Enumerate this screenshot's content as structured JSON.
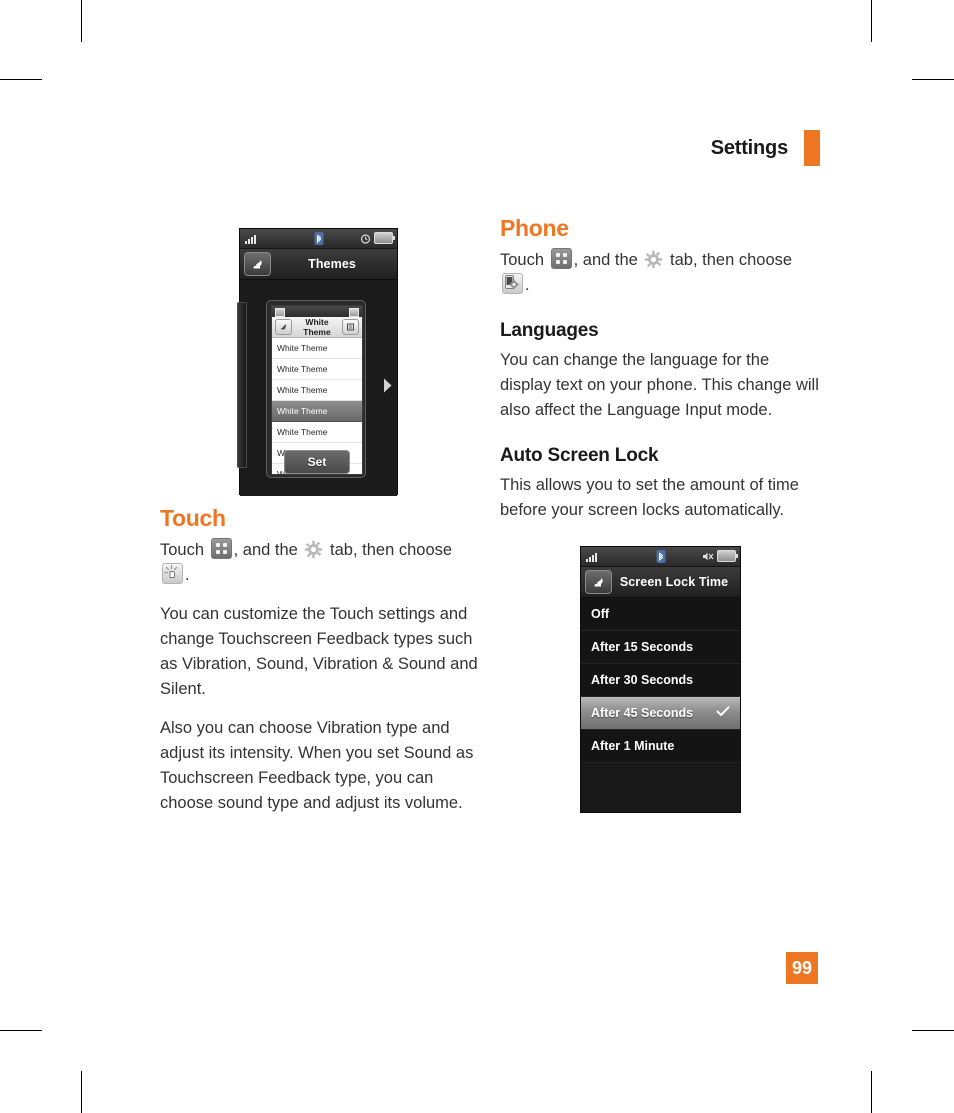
{
  "header": {
    "title": "Settings",
    "accent_color": "#EF7622"
  },
  "page_number": "99",
  "left_column": {
    "themes_screenshot": {
      "statusbar": {
        "signal_icon": "signal-bars-icon",
        "bluetooth_icon": "bluetooth-icon",
        "alarm_icon": "alarm-icon",
        "battery_icon": "battery-icon"
      },
      "back_icon": "back-arrow-icon",
      "title": "Themes",
      "preview": {
        "title": "White Theme",
        "back_icon": "back-arrow-icon",
        "menu_icon": "menu-icon",
        "rows": [
          "White Theme",
          "White Theme",
          "White Theme",
          "White Theme",
          "White Theme",
          "White Theme",
          "White Theme"
        ],
        "selected_index": 3
      },
      "set_button": "Set",
      "next_arrow_icon": "chevron-right-icon"
    },
    "touch": {
      "heading": "Touch",
      "instruction_pre": "Touch",
      "apps_icon": "apps-grid-icon",
      "instruction_mid": ", and the",
      "gear_icon": "gear-icon",
      "instruction_post": "tab, then choose",
      "touch_icon": "touch-feedback-icon",
      "instruction_end": ".",
      "paragraph_1": "You can customize the Touch settings and change Touchscreen Feedback types such as Vibration, Sound, Vibration & Sound and Silent.",
      "paragraph_2": "Also you can choose Vibration type and adjust its intensity. When you set Sound as Touchscreen Feedback type, you can choose sound type and adjust its volume."
    }
  },
  "right_column": {
    "phone": {
      "heading": "Phone",
      "instruction_pre": "Touch",
      "apps_icon": "apps-grid-icon",
      "instruction_mid": ", and the",
      "gear_icon": "gear-icon",
      "instruction_post": "tab, then choose",
      "phone_settings_icon": "phone-settings-icon",
      "instruction_end": "."
    },
    "languages": {
      "heading": "Languages",
      "paragraph": "You can change the language for the display text on your phone. This change will also affect the Language Input mode."
    },
    "auto_screen_lock": {
      "heading": "Auto Screen Lock",
      "paragraph": "This allows you to set the amount of time before your screen locks automatically."
    },
    "screen_lock_screenshot": {
      "statusbar": {
        "signal_icon": "signal-bars-icon",
        "bluetooth_icon": "bluetooth-icon",
        "mute_icon": "mute-icon",
        "battery_icon": "battery-icon"
      },
      "back_icon": "back-arrow-icon",
      "title": "Screen Lock Time",
      "options": [
        "Off",
        "After 15 Seconds",
        "After 30 Seconds",
        "After 45 Seconds",
        "After 1 Minute"
      ],
      "selected_index": 3,
      "check_icon": "check-icon"
    }
  }
}
